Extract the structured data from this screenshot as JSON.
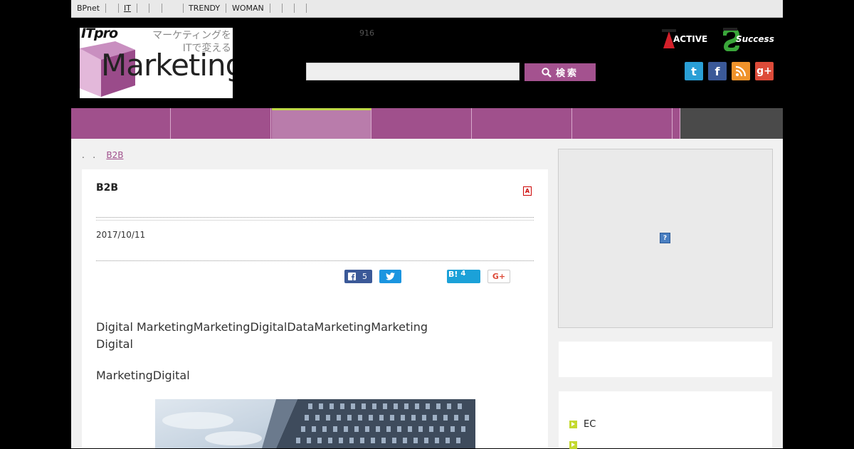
{
  "topbar": {
    "items": [
      "BPnet",
      "IT",
      "TRENDY",
      "WOMAN"
    ]
  },
  "logo": {
    "itpro": "ITpro",
    "tagline1": "マーケティングを",
    "tagline2": "ITで変える",
    "wordmark": "Marketing"
  },
  "counter": "916",
  "search": {
    "placeholder": "",
    "button_label": "検索",
    "button_icon": "search-icon"
  },
  "badges": {
    "active": "ACTIVE",
    "success": "Success"
  },
  "social": [
    {
      "name": "twitter-icon",
      "glyph": "t",
      "color": "#2a9fd6"
    },
    {
      "name": "facebook-icon",
      "glyph": "f",
      "color": "#3b5998"
    },
    {
      "name": "rss-icon",
      "glyph": "◉",
      "color": "#f0932b"
    },
    {
      "name": "google-plus-icon",
      "glyph": "g+",
      "color": "#dd4b39"
    }
  ],
  "colors": {
    "brand": "#a0508c",
    "active_tab": "#b97cab",
    "tab_accent": "#bfd847"
  },
  "breadcrumb": {
    "sep1": ".",
    "sep2": ".",
    "link": "B2B"
  },
  "article": {
    "title": "B2B",
    "date": "2017/10/11",
    "share": {
      "facebook_count": "5",
      "hatena_label": "B!",
      "hatena_count": "4",
      "gplus_label": "G+"
    },
    "para1_line1": "Digital MarketingMarketingDigitalDataMarketingMarketing",
    "para1_line2": "Digital",
    "para2": "MarketingDigital"
  },
  "sidebar": {
    "ad_icon": "?",
    "links": [
      "EC",
      ""
    ]
  }
}
